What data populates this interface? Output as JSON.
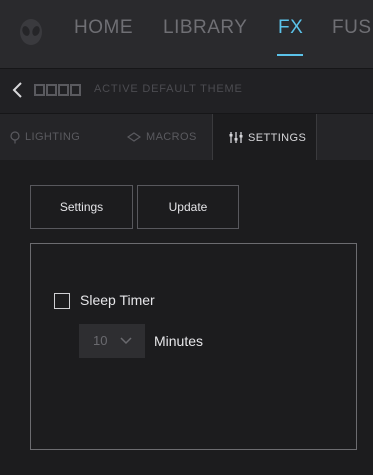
{
  "nav": {
    "items": [
      {
        "label": "HOME"
      },
      {
        "label": "LIBRARY"
      },
      {
        "label": "FX"
      },
      {
        "label": "FUS"
      }
    ],
    "active_index": 2
  },
  "subheader": {
    "title": "ACTIVE DEFAULT THEME"
  },
  "tabs": [
    {
      "label": "LIGHTING",
      "icon": "lightbulb-icon"
    },
    {
      "label": "MACROS",
      "icon": "macros-icon"
    },
    {
      "label": "SETTINGS",
      "icon": "sliders-icon"
    }
  ],
  "active_tab": 2,
  "buttons": {
    "settings_label": "Settings",
    "update_label": "Update"
  },
  "sleep_timer": {
    "label": "Sleep Timer",
    "checked": false,
    "selected_value": "10",
    "unit_label": "Minutes"
  },
  "colors": {
    "accent": "#5bc2e9",
    "background": "#1c1c1e"
  }
}
